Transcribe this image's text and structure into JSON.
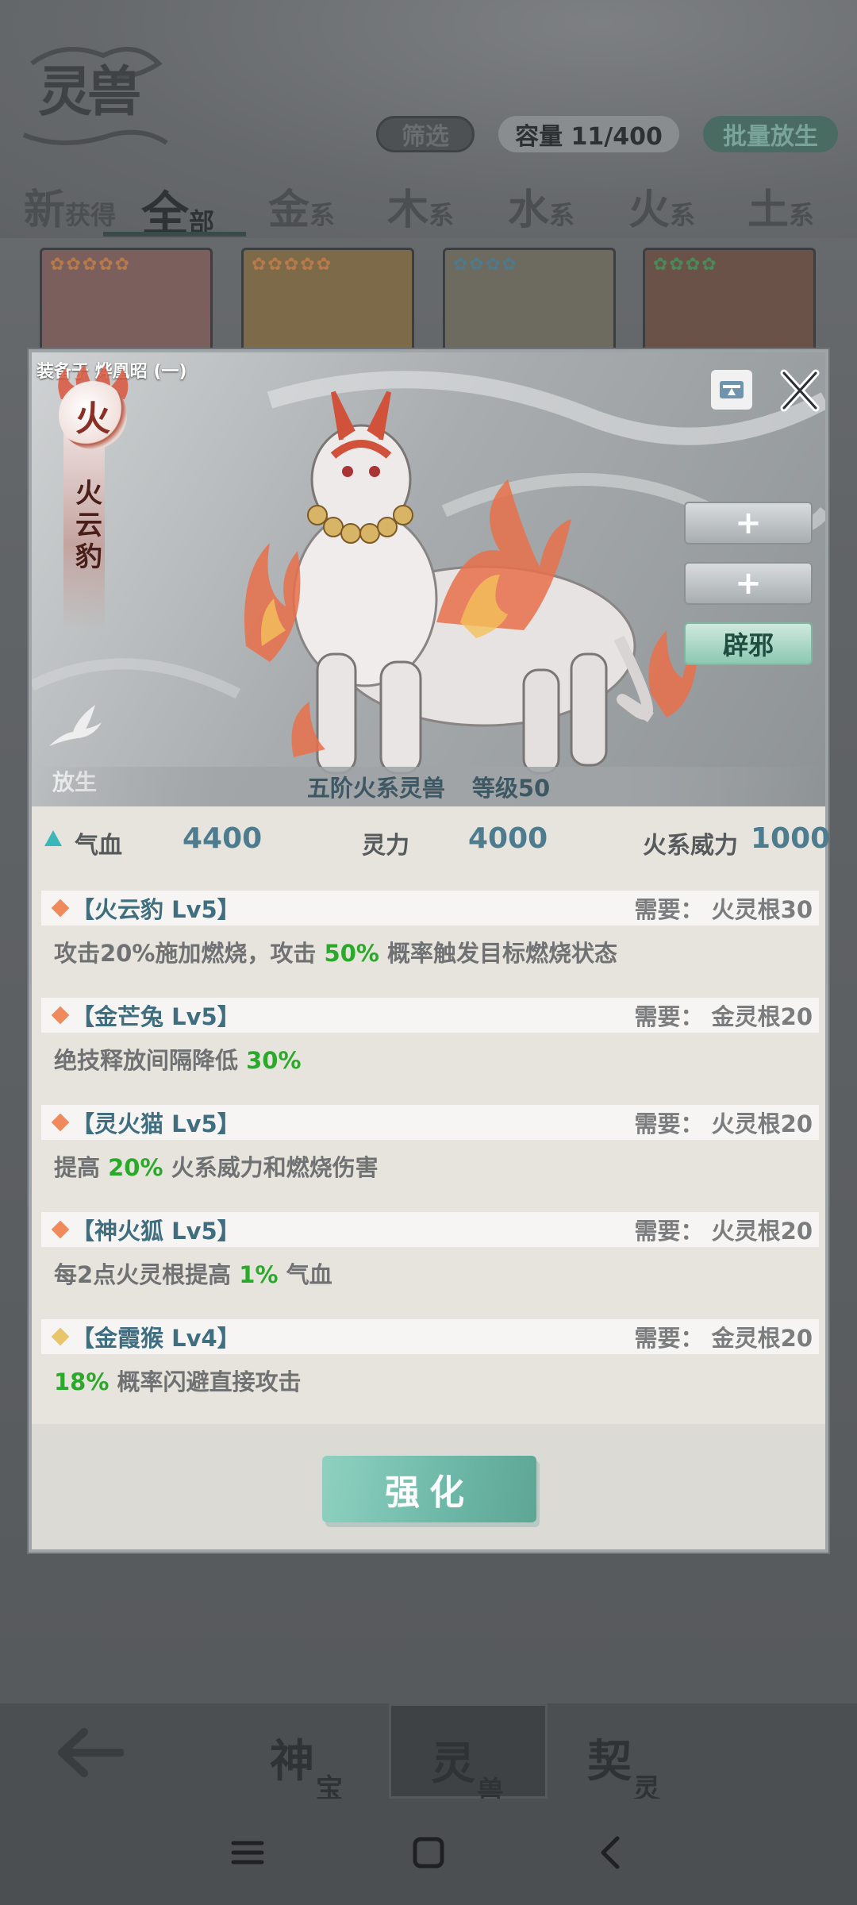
{
  "header": {
    "logo_text": "灵兽",
    "filter_label": "筛选",
    "capacity_label": "容量 11/400",
    "batch_release_label": "批量放生"
  },
  "tabs": [
    {
      "big": "新",
      "small": "获得"
    },
    {
      "big": "全",
      "small": "部"
    },
    {
      "big": "金",
      "small": "系"
    },
    {
      "big": "木",
      "small": "系"
    },
    {
      "big": "水",
      "small": "系"
    },
    {
      "big": "火",
      "small": "系"
    },
    {
      "big": "土",
      "small": "系"
    }
  ],
  "modal": {
    "equipped_label": "装备于 烨凰昭 (一)",
    "element_char": "火",
    "beast_name": "火云豹",
    "release_label": "放生",
    "slots": [
      "+",
      "+",
      "辟邪"
    ],
    "rank_text": "五阶火系灵兽",
    "level_text": "等级50",
    "stats": {
      "hp_label": "气血",
      "hp_value": "4400",
      "spirit_label": "灵力",
      "spirit_value": "4000",
      "fire_label": "火系威力",
      "fire_value": "1000"
    },
    "skills": [
      {
        "title": "【火云豹 Lv5】",
        "req": "需要： 火灵根30",
        "color": "#f08a5d",
        "desc_pre": "攻击20%施加燃烧，攻击 ",
        "desc_hl": "50%",
        "desc_post": " 概率触发目标燃烧状态"
      },
      {
        "title": "【金芒兔 Lv5】",
        "req": "需要： 金灵根20",
        "color": "#f08a5d",
        "desc_pre": "绝技释放间隔降低 ",
        "desc_hl": "30%",
        "desc_post": ""
      },
      {
        "title": "【灵火猫 Lv5】",
        "req": "需要： 火灵根20",
        "color": "#f08a5d",
        "desc_pre": "提高 ",
        "desc_hl": "20%",
        "desc_post": " 火系威力和燃烧伤害"
      },
      {
        "title": "【神火狐 Lv5】",
        "req": "需要： 火灵根20",
        "color": "#f08a5d",
        "desc_pre": "每2点火灵根提高 ",
        "desc_hl": "1%",
        "desc_post": " 气血"
      },
      {
        "title": "【金霞猴 Lv4】",
        "req": "需要： 金灵根20",
        "color": "#e8c46a",
        "desc_pre": "",
        "desc_hl": "18%",
        "desc_post": " 概率闪避直接攻击"
      }
    ],
    "enhance_label": "强化"
  },
  "bottom_nav": [
    {
      "big": "神",
      "small": "宝"
    },
    {
      "big": "灵",
      "small": "兽"
    },
    {
      "big": "契",
      "small": "灵"
    }
  ],
  "icons": {
    "close": "close-icon",
    "collapse": "collapse-icon",
    "release": "dove-icon",
    "back": "back-arrow-icon"
  }
}
